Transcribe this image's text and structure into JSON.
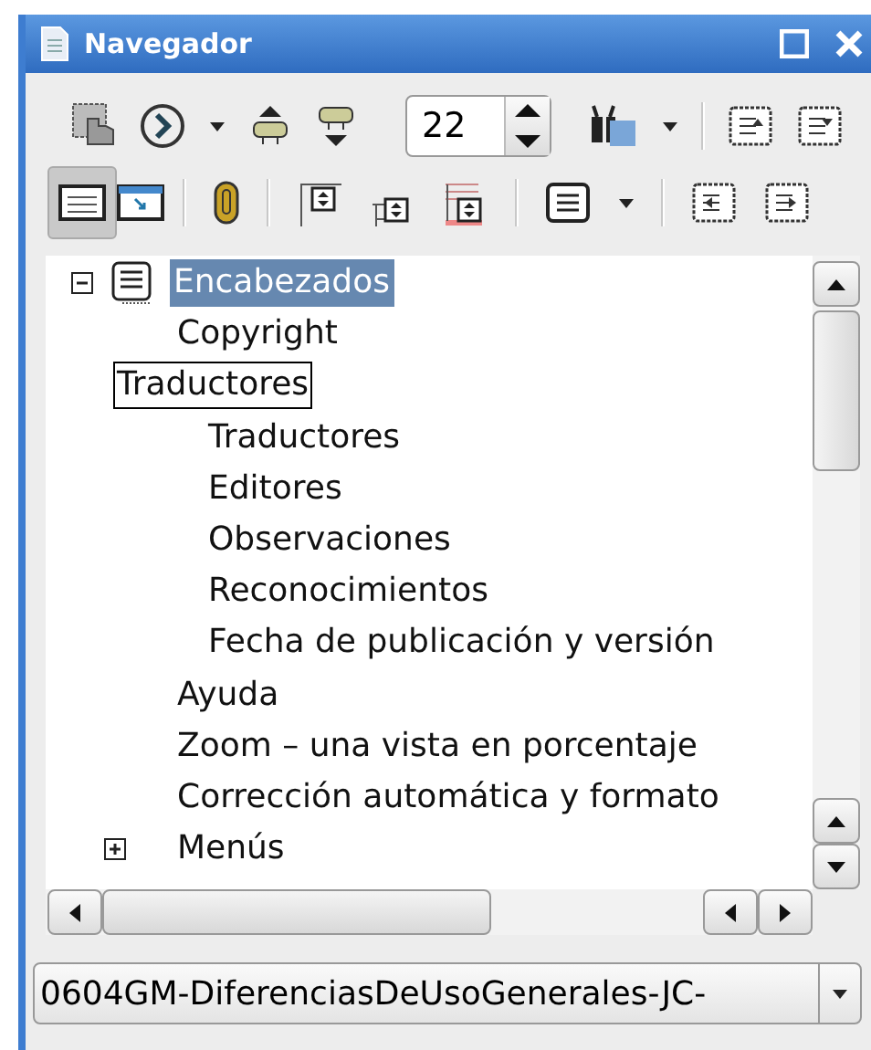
{
  "window": {
    "title": "Navegador"
  },
  "toolbar": {
    "page_number": "22",
    "view_toggles": [
      {
        "selected": true
      },
      {
        "selected": false
      }
    ]
  },
  "tree": [
    {
      "label": "Encabezados",
      "selected": true,
      "expanded": true,
      "children": [
        {
          "label": "Copyright",
          "selected": false
        },
        {
          "label": "Traductores",
          "selected": false,
          "focused": true,
          "children": [
            {
              "label": "Traductores",
              "selected": false
            },
            {
              "label": "Editores",
              "selected": false
            },
            {
              "label": "Observaciones",
              "selected": false
            },
            {
              "label": "Reconocimientos",
              "selected": false
            },
            {
              "label": "Fecha de publicación y versión",
              "selected": false
            }
          ]
        },
        {
          "label": "Ayuda",
          "selected": false
        },
        {
          "label": "Zoom – una vista en porcentaje",
          "selected": false
        },
        {
          "label": "Corrección automática y formato",
          "selected": false
        },
        {
          "label": "Menús",
          "selected": false,
          "expanded": false
        }
      ]
    }
  ],
  "document_select": {
    "value": "0604GM-DiferenciasDeUsoGenerales-JC-"
  }
}
